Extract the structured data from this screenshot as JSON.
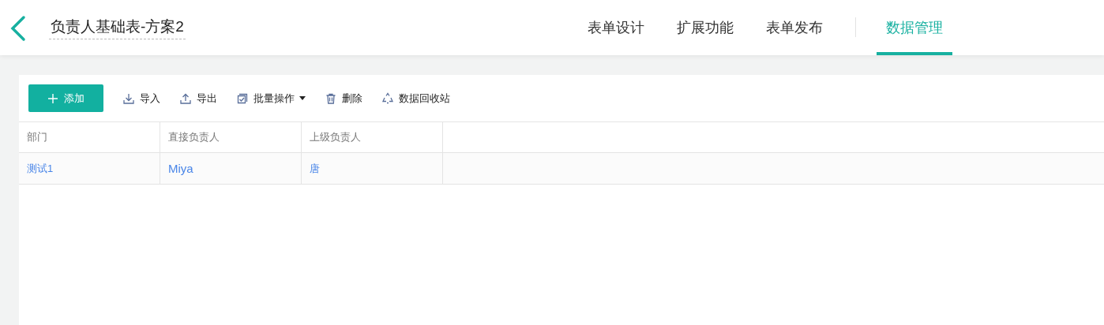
{
  "header": {
    "title": "负责人基础表-方案2"
  },
  "tabs": [
    {
      "label": "表单设计",
      "selected": false
    },
    {
      "label": "扩展功能",
      "selected": false
    },
    {
      "label": "表单发布",
      "selected": false
    },
    {
      "label": "数据管理",
      "selected": true
    }
  ],
  "toolbar": [
    {
      "label": "添加",
      "kind": "primary"
    },
    {
      "label": "导入",
      "kind": "plain"
    },
    {
      "label": "导出",
      "kind": "plain"
    },
    {
      "label": "批量操作",
      "kind": "menu"
    },
    {
      "label": "删除",
      "kind": "plain"
    },
    {
      "label": "数据回收站",
      "kind": "plain"
    }
  ],
  "table": {
    "columns": [
      "部门",
      "直接负责人",
      "上级负责人"
    ],
    "rows": [
      [
        "测试1",
        "Miya",
        "唐"
      ]
    ]
  }
}
